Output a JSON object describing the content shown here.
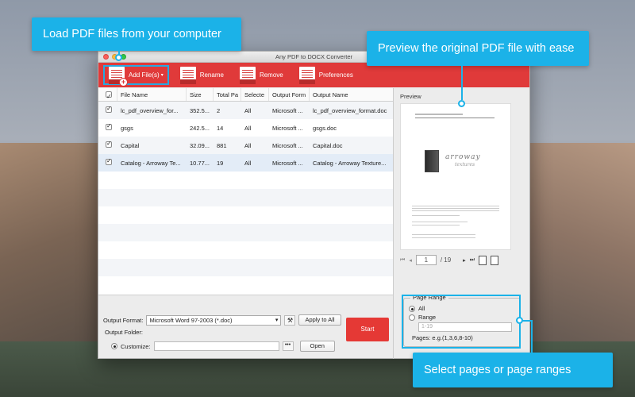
{
  "callouts": {
    "load": "Load PDF files from your computer",
    "preview": "Preview the original PDF file with ease",
    "pages": "Select pages or page ranges"
  },
  "window": {
    "title": "Any PDF to DOCX Converter"
  },
  "toolbar": {
    "add_label": "Add File(s)",
    "rename_label": "Rename",
    "remove_label": "Remove",
    "preferences_label": "Preferences"
  },
  "file_list": {
    "columns": [
      "File Name",
      "Size",
      "Total Pa",
      "Selecte",
      "Output Form",
      "Output Name"
    ],
    "rows": [
      {
        "checked": true,
        "file_name": "lc_pdf_overview_for...",
        "size": "352.5...",
        "total_pages": "2",
        "selected": "All",
        "output_format": "Microsoft ...",
        "output_name": "lc_pdf_overview_format.doc"
      },
      {
        "checked": true,
        "file_name": "gsgs",
        "size": "242.5...",
        "total_pages": "14",
        "selected": "All",
        "output_format": "Microsoft ...",
        "output_name": "gsgs.doc"
      },
      {
        "checked": true,
        "file_name": "Capital",
        "size": "32.09...",
        "total_pages": "881",
        "selected": "All",
        "output_format": "Microsoft ...",
        "output_name": "Capital.doc"
      },
      {
        "checked": true,
        "file_name": "Catalog - Arroway Te...",
        "size": "10.77...",
        "total_pages": "19",
        "selected": "All",
        "output_format": "Microsoft ...",
        "output_name": "Catalog - Arroway Texture..."
      }
    ]
  },
  "preview": {
    "label": "Preview",
    "brand": "arroway",
    "brand_sub": "textures",
    "current_page": "1",
    "total_pages": "/ 19"
  },
  "page_range": {
    "title": "Page Range",
    "all_label": "All",
    "range_label": "Range",
    "range_placeholder": "1-19",
    "hint": "Pages: e.g.(1,3,6,8-10)",
    "selected": "All"
  },
  "output": {
    "format_label": "Output Format:",
    "format_value": "Microsoft Word 97-2003 (*.doc)",
    "apply_all": "Apply to All",
    "folder_label": "Output Folder:",
    "customize_label": "Customize:",
    "browse": "•••",
    "open": "Open",
    "start": "Start"
  },
  "colors": {
    "accent_red": "#e03a3a",
    "callout_blue": "#1bb2e8"
  }
}
